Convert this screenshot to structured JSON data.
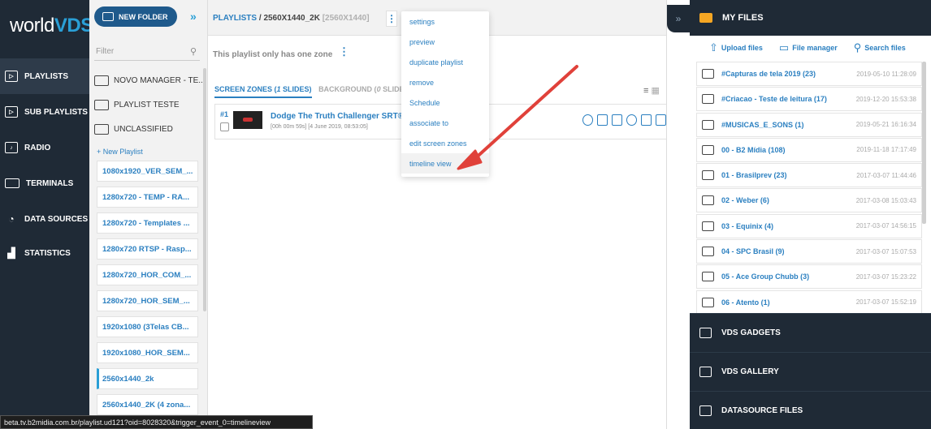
{
  "logo": {
    "text_a": "world",
    "text_b": "VDS"
  },
  "nav": {
    "items": [
      {
        "label": "PLAYLISTS",
        "icon": "playlist-icon"
      },
      {
        "label": "SUB PLAYLISTS",
        "icon": "sub-playlist-icon"
      },
      {
        "label": "RADIO",
        "icon": "radio-icon"
      },
      {
        "label": "TERMINALS",
        "icon": "terminal-icon"
      },
      {
        "label": "DATA SOURCES",
        "icon": "wifi-icon"
      },
      {
        "label": "STATISTICS",
        "icon": "chart-icon"
      }
    ]
  },
  "folders": {
    "new_folder_label": "NEW FOLDER",
    "filter_placeholder": "Filter",
    "items": [
      "NOVO MANAGER - TE...",
      "PLAYLIST TESTE",
      "UNCLASSIFIED"
    ],
    "new_playlist_label": "+ New Playlist",
    "playlists": [
      "1080x1920_VER_SEM_...",
      "1280x720 - TEMP - RA...",
      "1280x720 - Templates ...",
      "1280x720 RTSP - Rasp...",
      "1280x720_HOR_COM_...",
      "1280x720_HOR_SEM_...",
      "1920x1080 (3Telas CB...",
      "1920x1080_HOR_SEM...",
      "2560x1440_2k",
      "2560x1440_2K (4 zona..."
    ],
    "active_playlist": "2560x1440_2k"
  },
  "main": {
    "breadcrumb_root": "PLAYLISTS",
    "breadcrumb_sep": " / ",
    "breadcrumb_current": "2560X1440_2K",
    "breadcrumb_dim": " [2560X1440]",
    "zone_info": "This playlist only has one zone",
    "tabs": [
      {
        "prefix": "SCREEN ZONES (",
        "count": "1",
        "suffix": " SLIDES)"
      },
      {
        "prefix": "BACKGROUND (",
        "count": "0",
        "suffix": " SLIDES"
      }
    ],
    "slide": {
      "number": "#1",
      "title": "Dodge The Truth Challenger SRT® D",
      "meta": "[00h 00m 59s] [4 June 2019, 08:53:05]"
    }
  },
  "menu": {
    "items": [
      "settings",
      "preview",
      "duplicate playlist",
      "remove",
      "Schedule",
      "associate to",
      "edit screen zones",
      "timeline view"
    ],
    "highlighted": "timeline view"
  },
  "right": {
    "title": "MY FILES",
    "tools": [
      "Upload files",
      "File manager",
      "Search files"
    ],
    "files": [
      {
        "name": "#Capturas de tela 2019 (23)",
        "date": "2019-05-10 11:28:09"
      },
      {
        "name": "#Criacao - Teste de leitura (17)",
        "date": "2019-12-20 15:53:38"
      },
      {
        "name": "#MUSICAS_E_SONS (1)",
        "date": "2019-05-21 16:16:34"
      },
      {
        "name": "00 - B2 Mídia (108)",
        "date": "2019-11-18 17:17:49"
      },
      {
        "name": "01 - Brasilprev (23)",
        "date": "2017-03-07 11:44:46"
      },
      {
        "name": "02 - Weber (6)",
        "date": "2017-03-08 15:03:43"
      },
      {
        "name": "03 - Equinix (4)",
        "date": "2017-03-07 14:56:15"
      },
      {
        "name": "04 - SPC Brasil (9)",
        "date": "2017-03-07 15:07:53"
      },
      {
        "name": "05 - Ace Group Chubb (3)",
        "date": "2017-03-07 15:23:22"
      },
      {
        "name": "06 - Atento (1)",
        "date": "2017-03-07 15:52:19"
      }
    ],
    "sections": [
      "VDS GADGETS",
      "VDS GALLERY",
      "DATASOURCE FILES"
    ]
  },
  "status_url": "beta.tv.b2midia.com.br/playlist.ud121?oid=8028320&trigger_event_0=timelineview",
  "colors": {
    "nav_bg": "#1f2a36",
    "accent": "#2a7fc0",
    "arrow": "#e0413a",
    "folder_icon": "#f5a623"
  }
}
